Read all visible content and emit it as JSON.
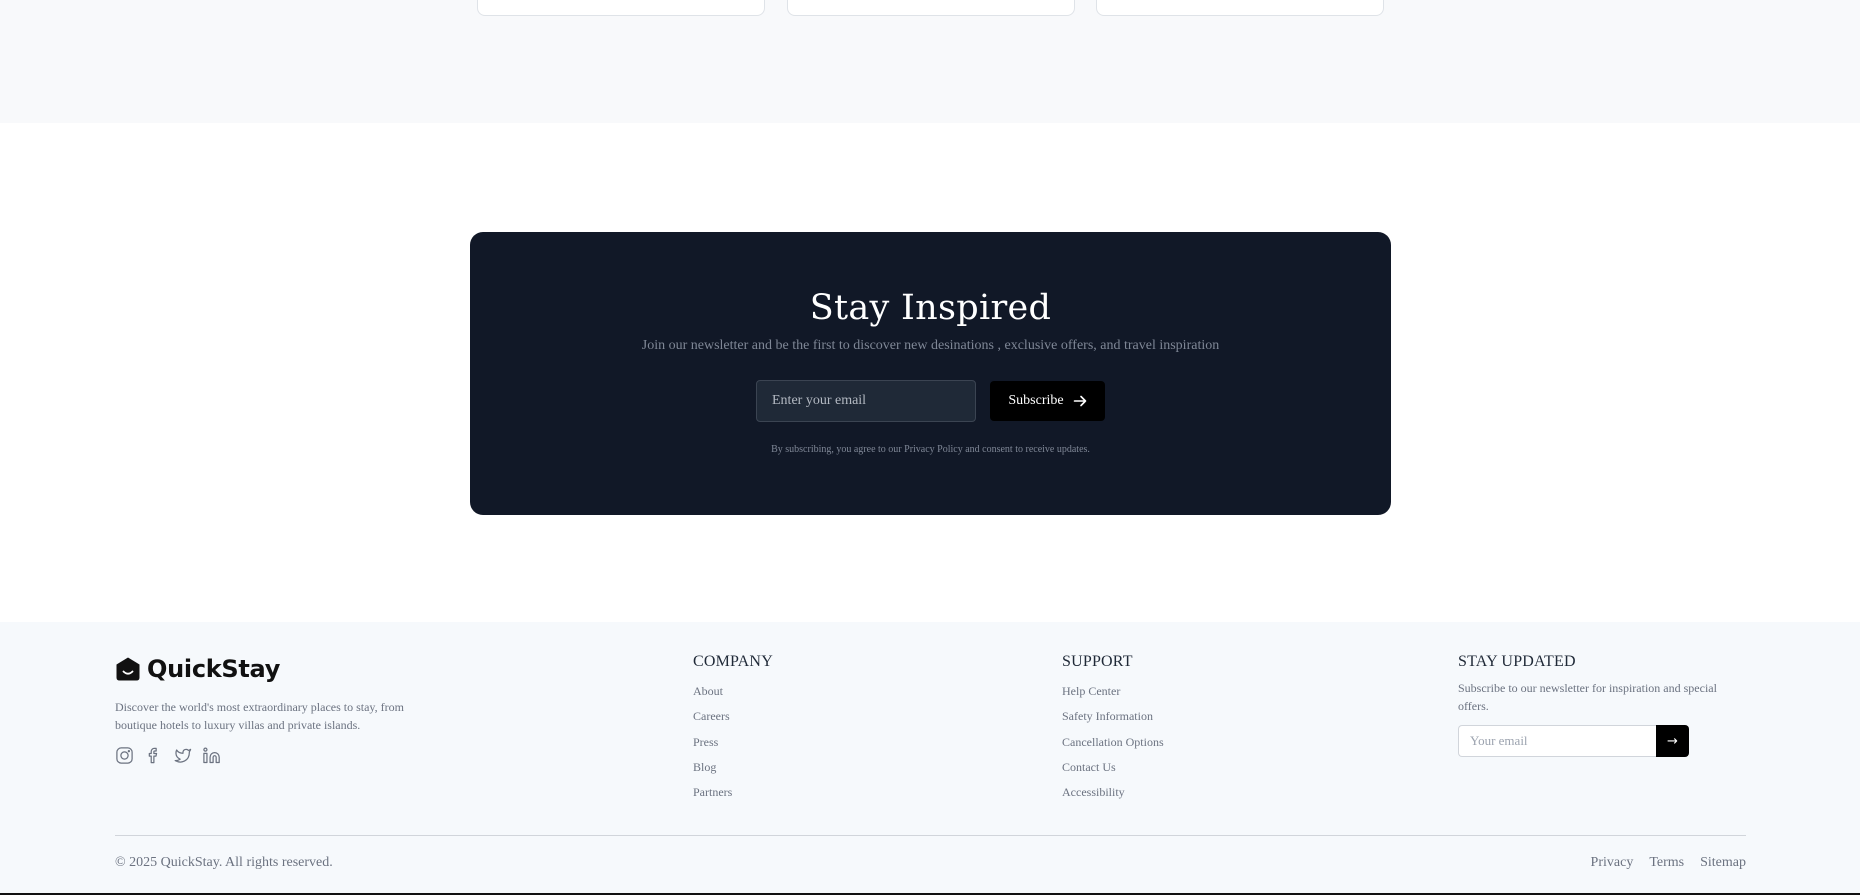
{
  "newsletter": {
    "title": "Stay Inspired",
    "subtitle": "Join our newsletter and be the first to discover new desinations , exclusive offers, and travel inspiration",
    "email_placeholder": "Enter your email",
    "subscribe_label": "Subscribe",
    "legal": "By subscribing, you agree to our Privacy Policy and consent to receive updates."
  },
  "footer": {
    "brand": {
      "name": "QuickStay",
      "description": "Discover the world's most extraordinary places to stay, from boutique hotels to luxury villas and private islands."
    },
    "socials": [
      "instagram-icon",
      "facebook-icon",
      "twitter-icon",
      "linkedin-icon"
    ],
    "company": {
      "heading": "COMPANY",
      "links": [
        "About",
        "Careers",
        "Press",
        "Blog",
        "Partners"
      ]
    },
    "support": {
      "heading": "SUPPORT",
      "links": [
        "Help Center",
        "Safety Information",
        "Cancellation Options",
        "Contact Us",
        "Accessibility"
      ]
    },
    "updates": {
      "heading": "STAY UPDATED",
      "text": "Subscribe to our newsletter for inspiration and special offers.",
      "email_placeholder": "Your email",
      "submit_glyph": "→"
    },
    "copyright": "© 2025 QuickStay. All rights reserved.",
    "legal_links": [
      "Privacy",
      "Terms",
      "Sitemap"
    ]
  },
  "colors": {
    "banner_bg": "#111827",
    "footer_bg": "#f6f9fc",
    "button_bg": "#000000"
  }
}
